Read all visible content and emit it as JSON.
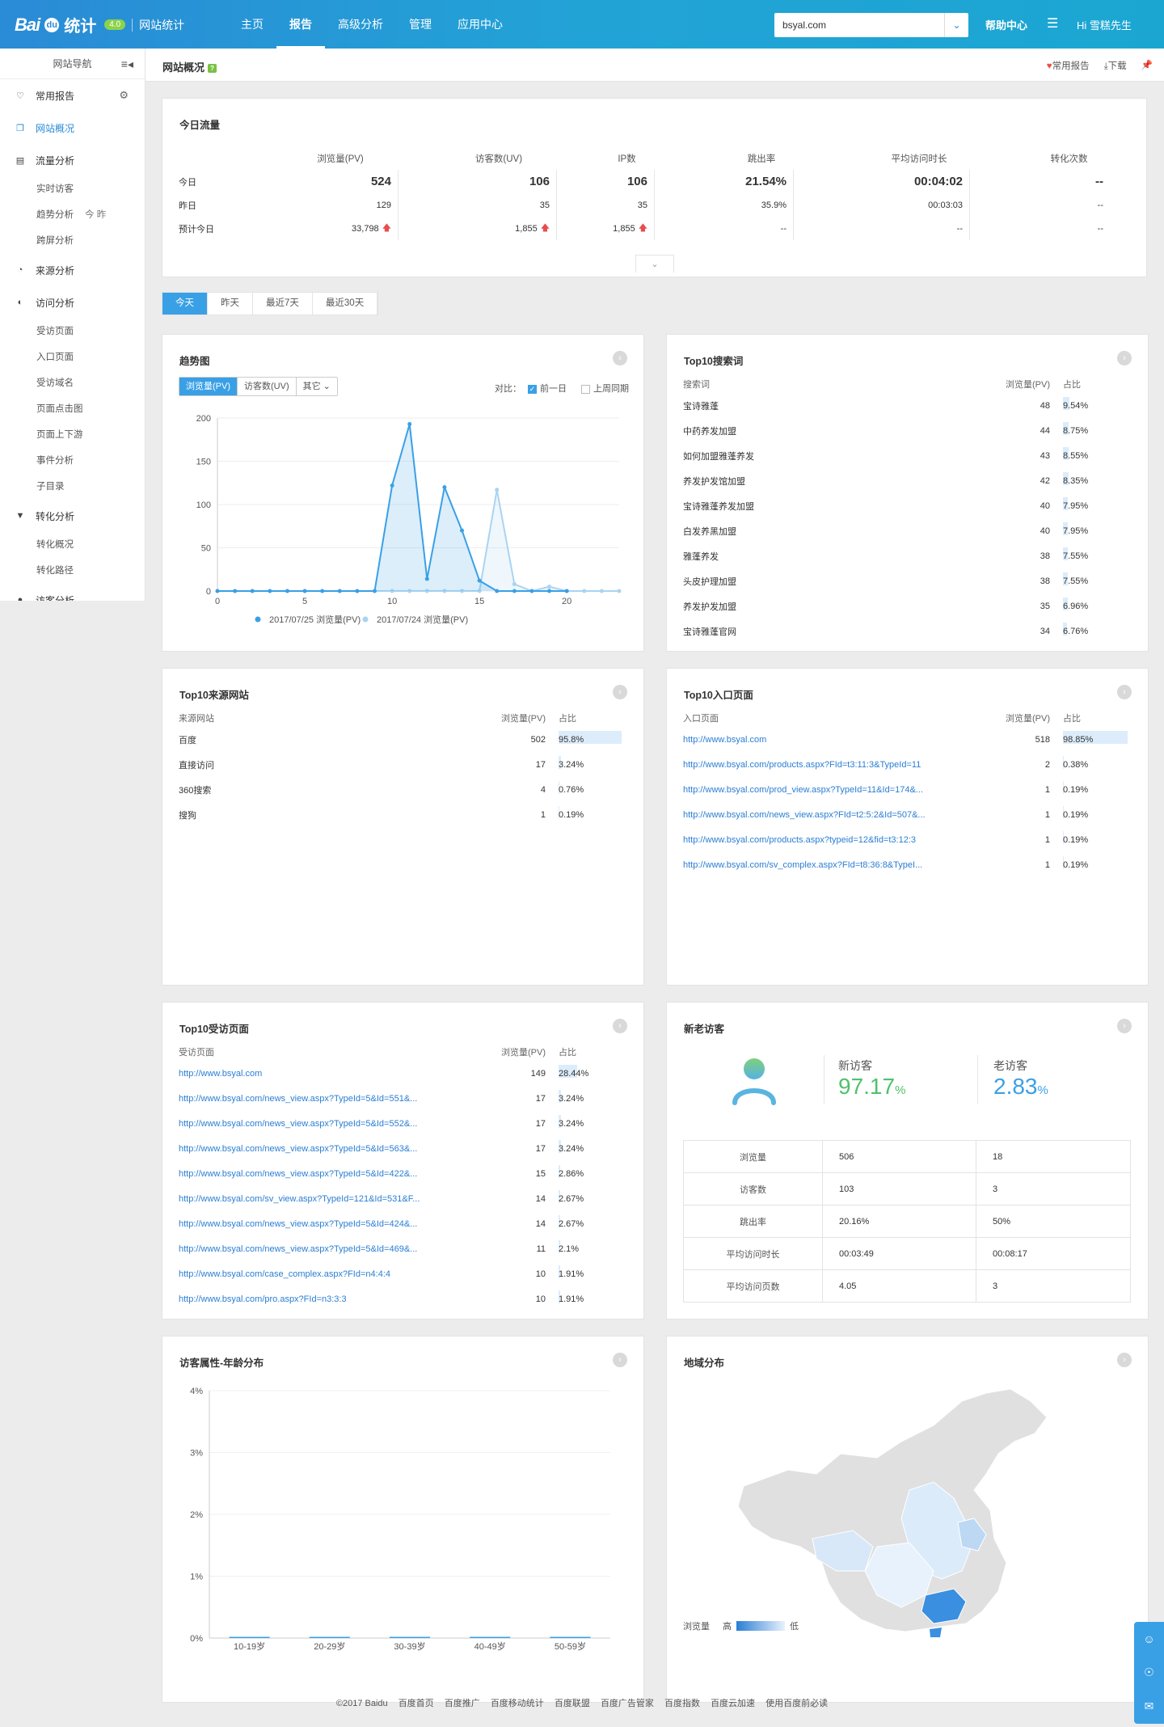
{
  "header": {
    "logo_bai": "Bai",
    "logo_du": "du",
    "logo_tongji": "统计",
    "version": "4.0",
    "product": "网站统计",
    "nav": [
      "主页",
      "报告",
      "高级分析",
      "管理",
      "应用中心"
    ],
    "nav_active": 1,
    "site": "bsyal.com",
    "help": "帮助中心",
    "user": "Hi  雪糕先生"
  },
  "sidebar": {
    "title": "网站导航",
    "groups": [
      {
        "label": "常用报告",
        "icon": "heart-icon"
      },
      {
        "label": "网站概况",
        "icon": "overview-icon"
      },
      {
        "label": "流量分析",
        "icon": "traffic-icon"
      },
      {
        "label": "来源分析",
        "icon": "pie-icon"
      },
      {
        "label": "访问分析",
        "icon": "visit-icon"
      },
      {
        "label": "转化分析",
        "icon": "funnel-icon"
      },
      {
        "label": "访客分析",
        "icon": "user-icon"
      }
    ],
    "traffic_subs": [
      "实时访客",
      "趋势分析",
      "跨屏分析"
    ],
    "trend_extra": "今  昨",
    "visit_subs": [
      "受访页面",
      "入口页面",
      "受访域名",
      "页面点击图",
      "页面上下游",
      "事件分析",
      "子目录"
    ],
    "conv_subs": [
      "转化概况",
      "转化路径"
    ]
  },
  "titlebar": {
    "title": "网站概况",
    "q": "?",
    "fav": "常用报告",
    "download": "下载"
  },
  "today": {
    "title": "今日流量",
    "headers": [
      "浏览量(PV)",
      "访客数(UV)",
      "IP数",
      "跳出率",
      "平均访问时长",
      "转化次数"
    ],
    "rows": [
      {
        "label": "今日",
        "values": [
          "524",
          "106",
          "106",
          "21.54%",
          "00:04:02",
          "--"
        ]
      },
      {
        "label": "昨日",
        "values": [
          "129",
          "35",
          "35",
          "35.9%",
          "00:03:03",
          "--"
        ]
      },
      {
        "label": "预计今日",
        "values": [
          "33,798",
          "1,855",
          "1,855",
          "--",
          "--",
          "--"
        ]
      }
    ]
  },
  "tabs": [
    "今天",
    "昨天",
    "最近7天",
    "最近30天"
  ],
  "trend": {
    "title": "趋势图",
    "seg": [
      "浏览量(PV)",
      "访客数(UV)",
      "其它"
    ],
    "compare_label": "对比：",
    "compare_prev": "前一日",
    "compare_week": "上周同期",
    "legend": [
      "2017/07/25 浏览量(PV)",
      "2017/07/24 浏览量(PV)"
    ]
  },
  "chart_data": [
    {
      "type": "area",
      "title": "趋势图",
      "x": [
        0,
        1,
        2,
        3,
        4,
        5,
        6,
        7,
        8,
        9,
        10,
        11,
        12,
        13,
        14,
        15,
        16,
        17,
        18,
        19,
        20,
        21,
        22,
        23
      ],
      "xticks": [
        0,
        5,
        10,
        15,
        20
      ],
      "yticks": [
        0,
        50,
        100,
        150,
        200
      ],
      "ylim": [
        0,
        200
      ],
      "series": [
        {
          "name": "2017/07/25 浏览量(PV)",
          "color": "#3aa0e6",
          "values": [
            0,
            0,
            0,
            0,
            0,
            0,
            0,
            0,
            0,
            0,
            122,
            193,
            14,
            120,
            70,
            12,
            0,
            0,
            0,
            0,
            0,
            null,
            null,
            null
          ]
        },
        {
          "name": "2017/07/24 浏览量(PV)",
          "color": "#a9d4f2",
          "values": [
            0,
            0,
            0,
            0,
            0,
            0,
            0,
            0,
            0,
            0,
            0,
            0,
            0,
            0,
            0,
            0,
            117,
            8,
            0,
            5,
            0,
            0,
            0,
            0
          ]
        }
      ]
    },
    {
      "type": "bar",
      "title": "访客属性-年龄分布",
      "categories": [
        "10-19岁",
        "20-29岁",
        "30-39岁",
        "40-49岁",
        "50-59岁"
      ],
      "values": [
        0,
        0,
        0,
        0,
        0
      ],
      "yticks": [
        "0%",
        "1%",
        "2%",
        "3%",
        "4%"
      ],
      "ylim": [
        0,
        4
      ]
    }
  ],
  "top_search": {
    "title": "Top10搜索词",
    "headers": [
      "搜索词",
      "浏览量(PV)",
      "占比"
    ],
    "rows": [
      [
        "宝诗雅蓬",
        "48",
        "9.54%"
      ],
      [
        "中药养发加盟",
        "44",
        "8.75%"
      ],
      [
        "如何加盟雅蓬养发",
        "43",
        "8.55%"
      ],
      [
        "养发护发馆加盟",
        "42",
        "8.35%"
      ],
      [
        "宝诗雅蓬养发加盟",
        "40",
        "7.95%"
      ],
      [
        "白发养黑加盟",
        "40",
        "7.95%"
      ],
      [
        "雅蓬养发",
        "38",
        "7.55%"
      ],
      [
        "头皮护理加盟",
        "38",
        "7.55%"
      ],
      [
        "养发护发加盟",
        "35",
        "6.96%"
      ],
      [
        "宝诗雅蓬官网",
        "34",
        "6.76%"
      ]
    ]
  },
  "top_source": {
    "title": "Top10来源网站",
    "headers": [
      "来源网站",
      "浏览量(PV)",
      "占比"
    ],
    "rows": [
      [
        "百度",
        "502",
        "95.8%"
      ],
      [
        "直接访问",
        "17",
        "3.24%"
      ],
      [
        "360搜索",
        "4",
        "0.76%"
      ],
      [
        "搜狗",
        "1",
        "0.19%"
      ]
    ]
  },
  "top_entry": {
    "title": "Top10入口页面",
    "headers": [
      "入口页面",
      "浏览量(PV)",
      "占比"
    ],
    "rows": [
      [
        "http://www.bsyal.com",
        "518",
        "98.85%"
      ],
      [
        "http://www.bsyal.com/products.aspx?FId=t3:11:3&TypeId=11",
        "2",
        "0.38%"
      ],
      [
        "http://www.bsyal.com/prod_view.aspx?TypeId=11&Id=174&...",
        "1",
        "0.19%"
      ],
      [
        "http://www.bsyal.com/news_view.aspx?FId=t2:5:2&Id=507&...",
        "1",
        "0.19%"
      ],
      [
        "http://www.bsyal.com/products.aspx?typeid=12&fid=t3:12:3",
        "1",
        "0.19%"
      ],
      [
        "http://www.bsyal.com/sv_complex.aspx?FId=t8:36:8&TypeI...",
        "1",
        "0.19%"
      ]
    ]
  },
  "top_visited": {
    "title": "Top10受访页面",
    "headers": [
      "受访页面",
      "浏览量(PV)",
      "占比"
    ],
    "rows": [
      [
        "http://www.bsyal.com",
        "149",
        "28.44%"
      ],
      [
        "http://www.bsyal.com/news_view.aspx?TypeId=5&Id=551&...",
        "17",
        "3.24%"
      ],
      [
        "http://www.bsyal.com/news_view.aspx?TypeId=5&Id=552&...",
        "17",
        "3.24%"
      ],
      [
        "http://www.bsyal.com/news_view.aspx?TypeId=5&Id=563&...",
        "17",
        "3.24%"
      ],
      [
        "http://www.bsyal.com/news_view.aspx?TypeId=5&Id=422&...",
        "15",
        "2.86%"
      ],
      [
        "http://www.bsyal.com/sv_view.aspx?TypeId=121&Id=531&F...",
        "14",
        "2.67%"
      ],
      [
        "http://www.bsyal.com/news_view.aspx?TypeId=5&Id=424&...",
        "14",
        "2.67%"
      ],
      [
        "http://www.bsyal.com/news_view.aspx?TypeId=5&Id=469&...",
        "11",
        "2.1%"
      ],
      [
        "http://www.bsyal.com/case_complex.aspx?FId=n4:4:4",
        "10",
        "1.91%"
      ],
      [
        "http://www.bsyal.com/pro.aspx?FId=n3:3:3",
        "10",
        "1.91%"
      ]
    ]
  },
  "new_old": {
    "title": "新老访客",
    "new_label": "新访客",
    "new_pct": "97.17",
    "old_label": "老访客",
    "old_pct": "2.83",
    "pct_sign": "%",
    "rows": [
      [
        "浏览量",
        "506",
        "18"
      ],
      [
        "访客数",
        "103",
        "3"
      ],
      [
        "跳出率",
        "20.16%",
        "50%"
      ],
      [
        "平均访问时长",
        "00:03:49",
        "00:08:17"
      ],
      [
        "平均访问页数",
        "4.05",
        "3"
      ]
    ]
  },
  "age": {
    "title": "访客属性-年龄分布"
  },
  "geo": {
    "title": "地域分布",
    "legend_label": "浏览量",
    "high": "高",
    "low": "低"
  },
  "footer": [
    "©2017 Baidu",
    "百度首页",
    "百度推广",
    "百度移动统计",
    "百度联盟",
    "百度广告管家",
    "百度指数",
    "百度云加速",
    "使用百度前必读"
  ]
}
